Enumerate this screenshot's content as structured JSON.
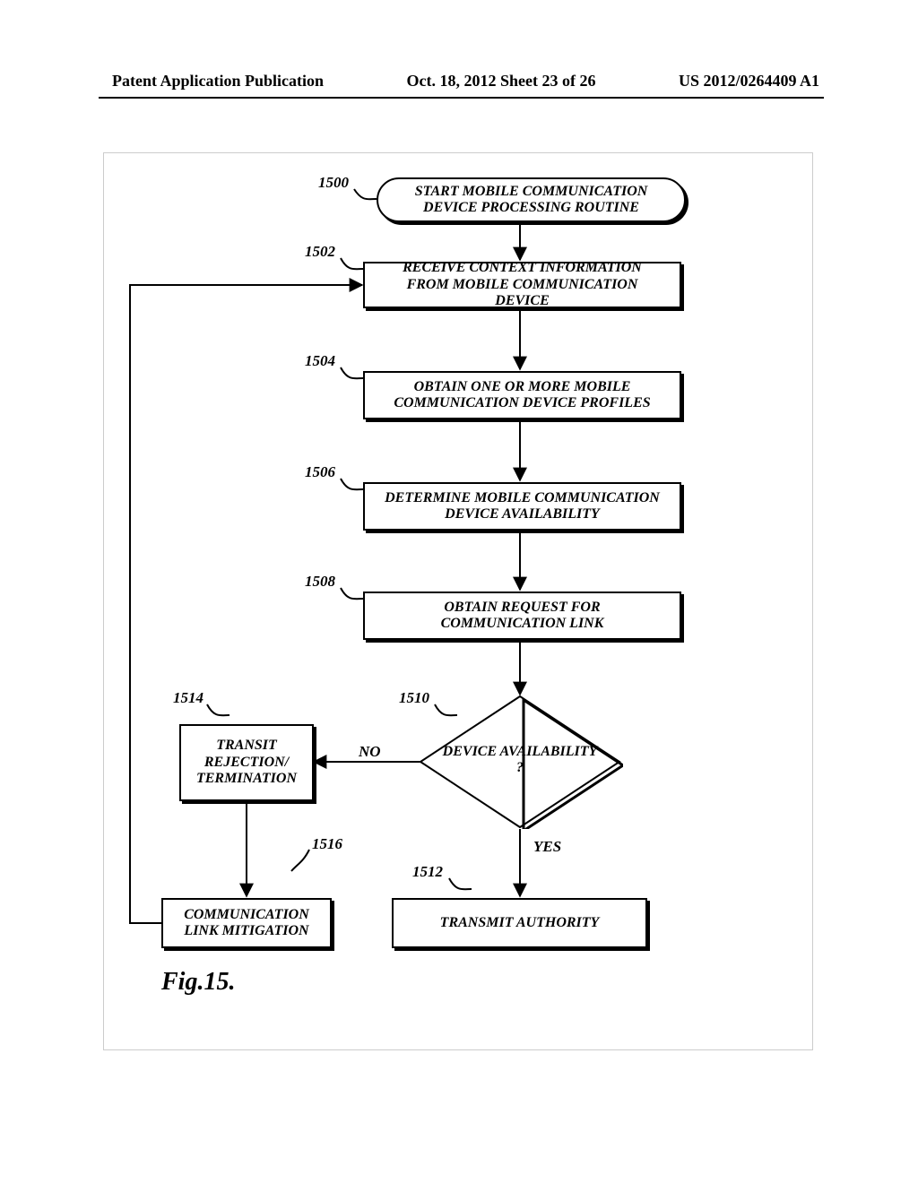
{
  "header": {
    "left": "Patent Application Publication",
    "center": "Oct. 18, 2012  Sheet 23 of 26",
    "right": "US 2012/0264409 A1"
  },
  "figure_caption": "Fig.15.",
  "refs": {
    "r1500": "1500",
    "r1502": "1502",
    "r1504": "1504",
    "r1506": "1506",
    "r1508": "1508",
    "r1510": "1510",
    "r1512": "1512",
    "r1514": "1514",
    "r1516": "1516"
  },
  "nodes": {
    "start": "START MOBILE COMMUNICATION DEVICE PROCESSING ROUTINE",
    "n1502": "RECEIVE CONTEXT INFORMATION FROM MOBILE COMMUNICATION DEVICE",
    "n1504": "OBTAIN ONE OR MORE MOBILE COMMUNICATION DEVICE PROFILES",
    "n1506": "DETERMINE MOBILE COMMUNICATION DEVICE AVAILABILITY",
    "n1508": "OBTAIN REQUEST FOR COMMUNICATION LINK",
    "n1510": "DEVICE AVAILABILITY ?",
    "n1512": "TRANSMIT AUTHORITY",
    "n1514": "TRANSIT REJECTION/ TERMINATION",
    "n1516": "COMMUNICATION LINK MITIGATION"
  },
  "branches": {
    "no": "NO",
    "yes": "YES"
  }
}
